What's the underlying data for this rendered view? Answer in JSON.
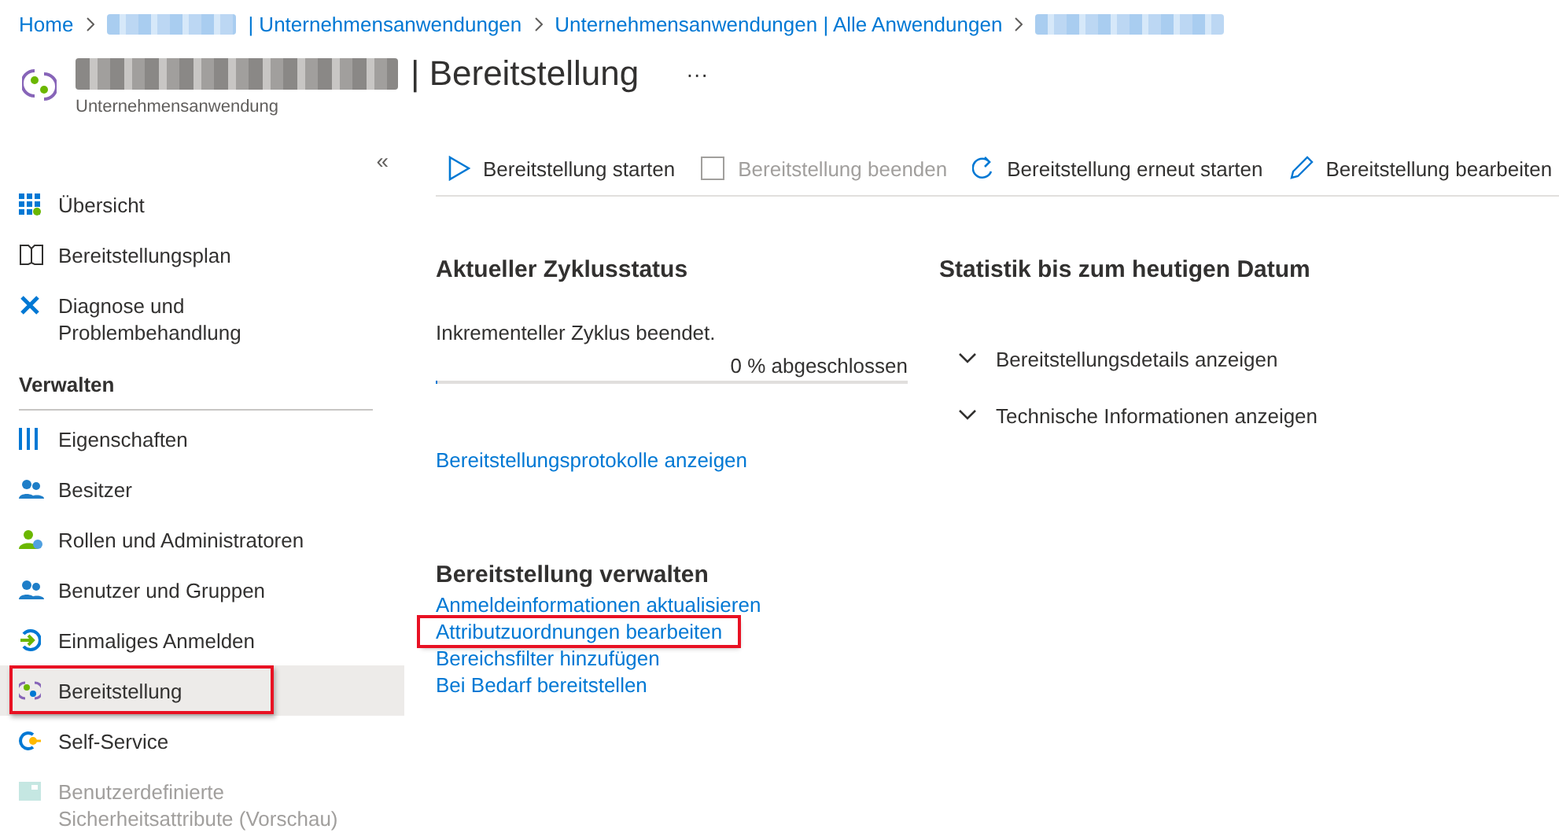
{
  "breadcrumb": [
    {
      "kind": "link",
      "text": "Home"
    },
    {
      "kind": "redacted_prefix",
      "text": "| Unternehmensanwendungen"
    },
    {
      "kind": "link",
      "text": "Unternehmensanwendungen | Alle Anwendungen"
    },
    {
      "kind": "redacted"
    }
  ],
  "header": {
    "title_suffix": "| Bereitstellung",
    "more": "···",
    "subtitle": "Unternehmensanwendung"
  },
  "sidebar": {
    "collapse": "«",
    "items": [
      {
        "kind": "item",
        "label": "Übersicht",
        "selected": false,
        "disabled": false,
        "highlighted": false
      },
      {
        "kind": "item",
        "label": "Bereitstellungsplan",
        "selected": false,
        "disabled": false,
        "highlighted": false
      },
      {
        "kind": "item",
        "label": "Diagnose und Problembehandlung",
        "selected": false,
        "disabled": false,
        "highlighted": false
      },
      {
        "kind": "heading",
        "label": "Verwalten"
      },
      {
        "kind": "item",
        "label": "Eigenschaften",
        "selected": false,
        "disabled": false,
        "highlighted": false
      },
      {
        "kind": "item",
        "label": "Besitzer",
        "selected": false,
        "disabled": false,
        "highlighted": false
      },
      {
        "kind": "item",
        "label": "Rollen und Administratoren",
        "selected": false,
        "disabled": false,
        "highlighted": false
      },
      {
        "kind": "item",
        "label": "Benutzer und Gruppen",
        "selected": false,
        "disabled": false,
        "highlighted": false
      },
      {
        "kind": "item",
        "label": "Einmaliges Anmelden",
        "selected": false,
        "disabled": false,
        "highlighted": false
      },
      {
        "kind": "item",
        "label": "Bereitstellung",
        "selected": true,
        "disabled": false,
        "highlighted": true
      },
      {
        "kind": "item",
        "label": "Self-Service",
        "selected": false,
        "disabled": false,
        "highlighted": false
      },
      {
        "kind": "item",
        "label": "Benutzerdefinierte Sicherheitsattribute (Vorschau)",
        "selected": false,
        "disabled": true,
        "highlighted": false
      }
    ]
  },
  "toolbar": [
    {
      "label": "Bereitstellung starten",
      "disabled": false
    },
    {
      "label": "Bereitstellung beenden",
      "disabled": true
    },
    {
      "label": "Bereitstellung erneut starten",
      "disabled": false
    },
    {
      "label": "Bereitstellung bearbeiten",
      "disabled": false
    }
  ],
  "cycle_status": {
    "title": "Aktueller Zyklusstatus",
    "message": "Inkrementeller Zyklus beendet.",
    "progress_label": "0 % abgeschlossen",
    "level": 0,
    "log_link": "Bereitstellungsprotokolle anzeigen"
  },
  "statistics": {
    "title": "Statistik bis zum heutigen Datum",
    "expanders": [
      {
        "label": "Bereitstellungsdetails anzeigen",
        "expanded": false
      },
      {
        "label": "Technische Informationen anzeigen",
        "expanded": false
      }
    ]
  },
  "manage": {
    "title": "Bereitstellung verwalten",
    "links": [
      {
        "label": "Anmeldeinformationen aktualisieren",
        "highlighted": false
      },
      {
        "label": "Attributzuordnungen bearbeiten",
        "highlighted": true
      },
      {
        "label": "Bereichsfilter hinzufügen",
        "highlighted": false
      },
      {
        "label": "Bei Bedarf bereitstellen",
        "highlighted": false
      }
    ]
  }
}
